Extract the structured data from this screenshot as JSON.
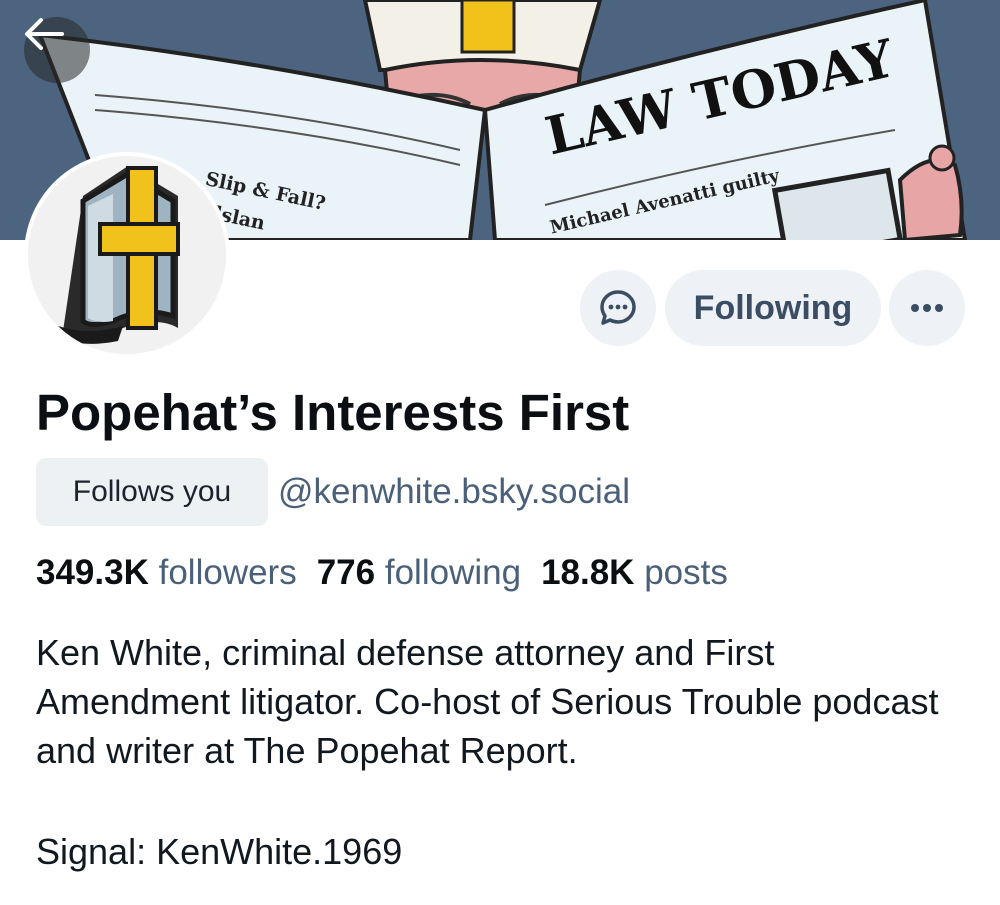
{
  "colors": {
    "banner_bg": "#4c6480",
    "button_bg": "#eef1f5",
    "handle_text": "#4a5f78",
    "name_text": "#0b0f14"
  },
  "banner": {
    "newspaper_title": "LAW TODAY",
    "left_page_text": "Slip & Fall?",
    "left_page_text_2": "elslan",
    "headline": "Michael Avenatti guilty"
  },
  "nav": {
    "back_icon": "arrow-left-icon"
  },
  "actions": {
    "message_icon": "chat-bubble-icon",
    "following_label": "Following",
    "more_icon": "ellipsis-icon"
  },
  "profile": {
    "display_name": "Popehat’s Interests First",
    "follows_you_label": "Follows you",
    "handle": "@kenwhite.bsky.social"
  },
  "stats": {
    "followers_count": "349.3K",
    "followers_label": "followers",
    "following_count": "776",
    "following_label": "following",
    "posts_count": "18.8K",
    "posts_label": "posts"
  },
  "bio": {
    "text": "Ken White, criminal defense attorney and First Amendment litigator.  Co-host of Serious Trouble podcast and writer at The Popehat Report.",
    "signal": "Signal:  KenWhite.1969"
  }
}
